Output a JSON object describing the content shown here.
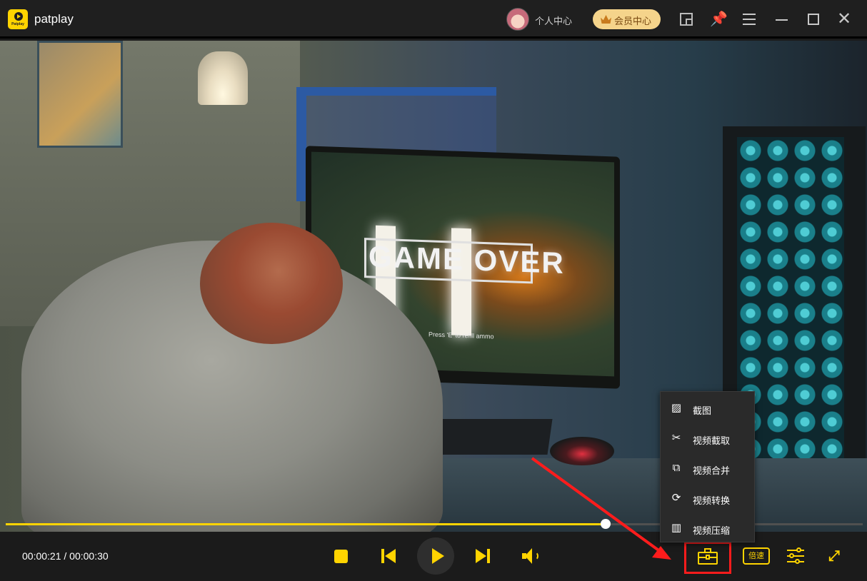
{
  "app": {
    "title": "patplay",
    "logo_text": "Patplay"
  },
  "header": {
    "user_label": "个人中心",
    "vip_label": "会员中心"
  },
  "video": {
    "screen_text": "GAME OVER",
    "screen_hint": "Press 'E' to refill ammo"
  },
  "player": {
    "current_time": "00:00:21",
    "total_time": "00:00:30",
    "time_display": "00:00:21 / 00:00:30",
    "progress": 0.7,
    "speed_label": "倍速"
  },
  "tools_menu": {
    "items": [
      {
        "label": "截图",
        "icon": "screenshot-icon"
      },
      {
        "label": "视频截取",
        "icon": "scissors-icon"
      },
      {
        "label": "视频合并",
        "icon": "merge-icon"
      },
      {
        "label": "视频转换",
        "icon": "convert-icon"
      },
      {
        "label": "视频压缩",
        "icon": "compress-icon"
      }
    ]
  },
  "colors": {
    "accent": "#ffd400",
    "highlight": "#ff1c1c",
    "background": "#1b1b1b"
  }
}
